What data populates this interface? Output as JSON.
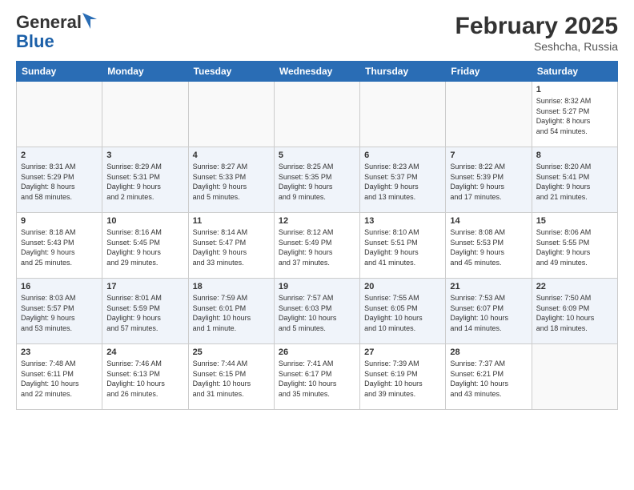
{
  "header": {
    "logo_general": "General",
    "logo_blue": "Blue",
    "month_year": "February 2025",
    "location": "Seshcha, Russia"
  },
  "days_of_week": [
    "Sunday",
    "Monday",
    "Tuesday",
    "Wednesday",
    "Thursday",
    "Friday",
    "Saturday"
  ],
  "weeks": [
    [
      {
        "day": "",
        "info": ""
      },
      {
        "day": "",
        "info": ""
      },
      {
        "day": "",
        "info": ""
      },
      {
        "day": "",
        "info": ""
      },
      {
        "day": "",
        "info": ""
      },
      {
        "day": "",
        "info": ""
      },
      {
        "day": "1",
        "info": "Sunrise: 8:32 AM\nSunset: 5:27 PM\nDaylight: 8 hours\nand 54 minutes."
      }
    ],
    [
      {
        "day": "2",
        "info": "Sunrise: 8:31 AM\nSunset: 5:29 PM\nDaylight: 8 hours\nand 58 minutes."
      },
      {
        "day": "3",
        "info": "Sunrise: 8:29 AM\nSunset: 5:31 PM\nDaylight: 9 hours\nand 2 minutes."
      },
      {
        "day": "4",
        "info": "Sunrise: 8:27 AM\nSunset: 5:33 PM\nDaylight: 9 hours\nand 5 minutes."
      },
      {
        "day": "5",
        "info": "Sunrise: 8:25 AM\nSunset: 5:35 PM\nDaylight: 9 hours\nand 9 minutes."
      },
      {
        "day": "6",
        "info": "Sunrise: 8:23 AM\nSunset: 5:37 PM\nDaylight: 9 hours\nand 13 minutes."
      },
      {
        "day": "7",
        "info": "Sunrise: 8:22 AM\nSunset: 5:39 PM\nDaylight: 9 hours\nand 17 minutes."
      },
      {
        "day": "8",
        "info": "Sunrise: 8:20 AM\nSunset: 5:41 PM\nDaylight: 9 hours\nand 21 minutes."
      }
    ],
    [
      {
        "day": "9",
        "info": "Sunrise: 8:18 AM\nSunset: 5:43 PM\nDaylight: 9 hours\nand 25 minutes."
      },
      {
        "day": "10",
        "info": "Sunrise: 8:16 AM\nSunset: 5:45 PM\nDaylight: 9 hours\nand 29 minutes."
      },
      {
        "day": "11",
        "info": "Sunrise: 8:14 AM\nSunset: 5:47 PM\nDaylight: 9 hours\nand 33 minutes."
      },
      {
        "day": "12",
        "info": "Sunrise: 8:12 AM\nSunset: 5:49 PM\nDaylight: 9 hours\nand 37 minutes."
      },
      {
        "day": "13",
        "info": "Sunrise: 8:10 AM\nSunset: 5:51 PM\nDaylight: 9 hours\nand 41 minutes."
      },
      {
        "day": "14",
        "info": "Sunrise: 8:08 AM\nSunset: 5:53 PM\nDaylight: 9 hours\nand 45 minutes."
      },
      {
        "day": "15",
        "info": "Sunrise: 8:06 AM\nSunset: 5:55 PM\nDaylight: 9 hours\nand 49 minutes."
      }
    ],
    [
      {
        "day": "16",
        "info": "Sunrise: 8:03 AM\nSunset: 5:57 PM\nDaylight: 9 hours\nand 53 minutes."
      },
      {
        "day": "17",
        "info": "Sunrise: 8:01 AM\nSunset: 5:59 PM\nDaylight: 9 hours\nand 57 minutes."
      },
      {
        "day": "18",
        "info": "Sunrise: 7:59 AM\nSunset: 6:01 PM\nDaylight: 10 hours\nand 1 minute."
      },
      {
        "day": "19",
        "info": "Sunrise: 7:57 AM\nSunset: 6:03 PM\nDaylight: 10 hours\nand 5 minutes."
      },
      {
        "day": "20",
        "info": "Sunrise: 7:55 AM\nSunset: 6:05 PM\nDaylight: 10 hours\nand 10 minutes."
      },
      {
        "day": "21",
        "info": "Sunrise: 7:53 AM\nSunset: 6:07 PM\nDaylight: 10 hours\nand 14 minutes."
      },
      {
        "day": "22",
        "info": "Sunrise: 7:50 AM\nSunset: 6:09 PM\nDaylight: 10 hours\nand 18 minutes."
      }
    ],
    [
      {
        "day": "23",
        "info": "Sunrise: 7:48 AM\nSunset: 6:11 PM\nDaylight: 10 hours\nand 22 minutes."
      },
      {
        "day": "24",
        "info": "Sunrise: 7:46 AM\nSunset: 6:13 PM\nDaylight: 10 hours\nand 26 minutes."
      },
      {
        "day": "25",
        "info": "Sunrise: 7:44 AM\nSunset: 6:15 PM\nDaylight: 10 hours\nand 31 minutes."
      },
      {
        "day": "26",
        "info": "Sunrise: 7:41 AM\nSunset: 6:17 PM\nDaylight: 10 hours\nand 35 minutes."
      },
      {
        "day": "27",
        "info": "Sunrise: 7:39 AM\nSunset: 6:19 PM\nDaylight: 10 hours\nand 39 minutes."
      },
      {
        "day": "28",
        "info": "Sunrise: 7:37 AM\nSunset: 6:21 PM\nDaylight: 10 hours\nand 43 minutes."
      },
      {
        "day": "",
        "info": ""
      }
    ]
  ]
}
